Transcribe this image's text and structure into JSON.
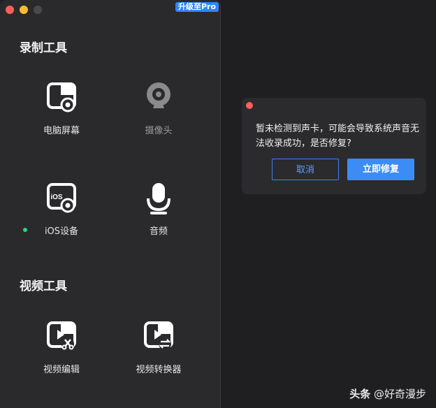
{
  "app": {
    "upgrade_label": "升级至Pro",
    "sections": [
      {
        "title": "录制工具"
      },
      {
        "title": "视频工具"
      }
    ],
    "tools": {
      "screen": {
        "label": "电脑屏幕",
        "icon": "screen-record-icon"
      },
      "camera": {
        "label": "摄像头",
        "icon": "webcam-icon"
      },
      "ios": {
        "label": "iOS设备",
        "icon": "ios-device-icon",
        "icon_text": "iOS"
      },
      "audio": {
        "label": "音频",
        "icon": "microphone-icon"
      },
      "editor": {
        "label": "视频编辑",
        "icon": "video-edit-icon"
      },
      "converter": {
        "label": "视频转换器",
        "icon": "video-convert-icon"
      }
    }
  },
  "dialog": {
    "message": "暂未检测到声卡，可能会导致系统声音无法收录成功，是否修复?",
    "cancel_label": "取消",
    "fix_label": "立即修复"
  },
  "watermark": {
    "brand": "头条",
    "handle": "@好奇漫步"
  },
  "colors": {
    "accent": "#3b8cf5",
    "status_green": "#2ed47a",
    "close_red": "#fe5f57"
  }
}
